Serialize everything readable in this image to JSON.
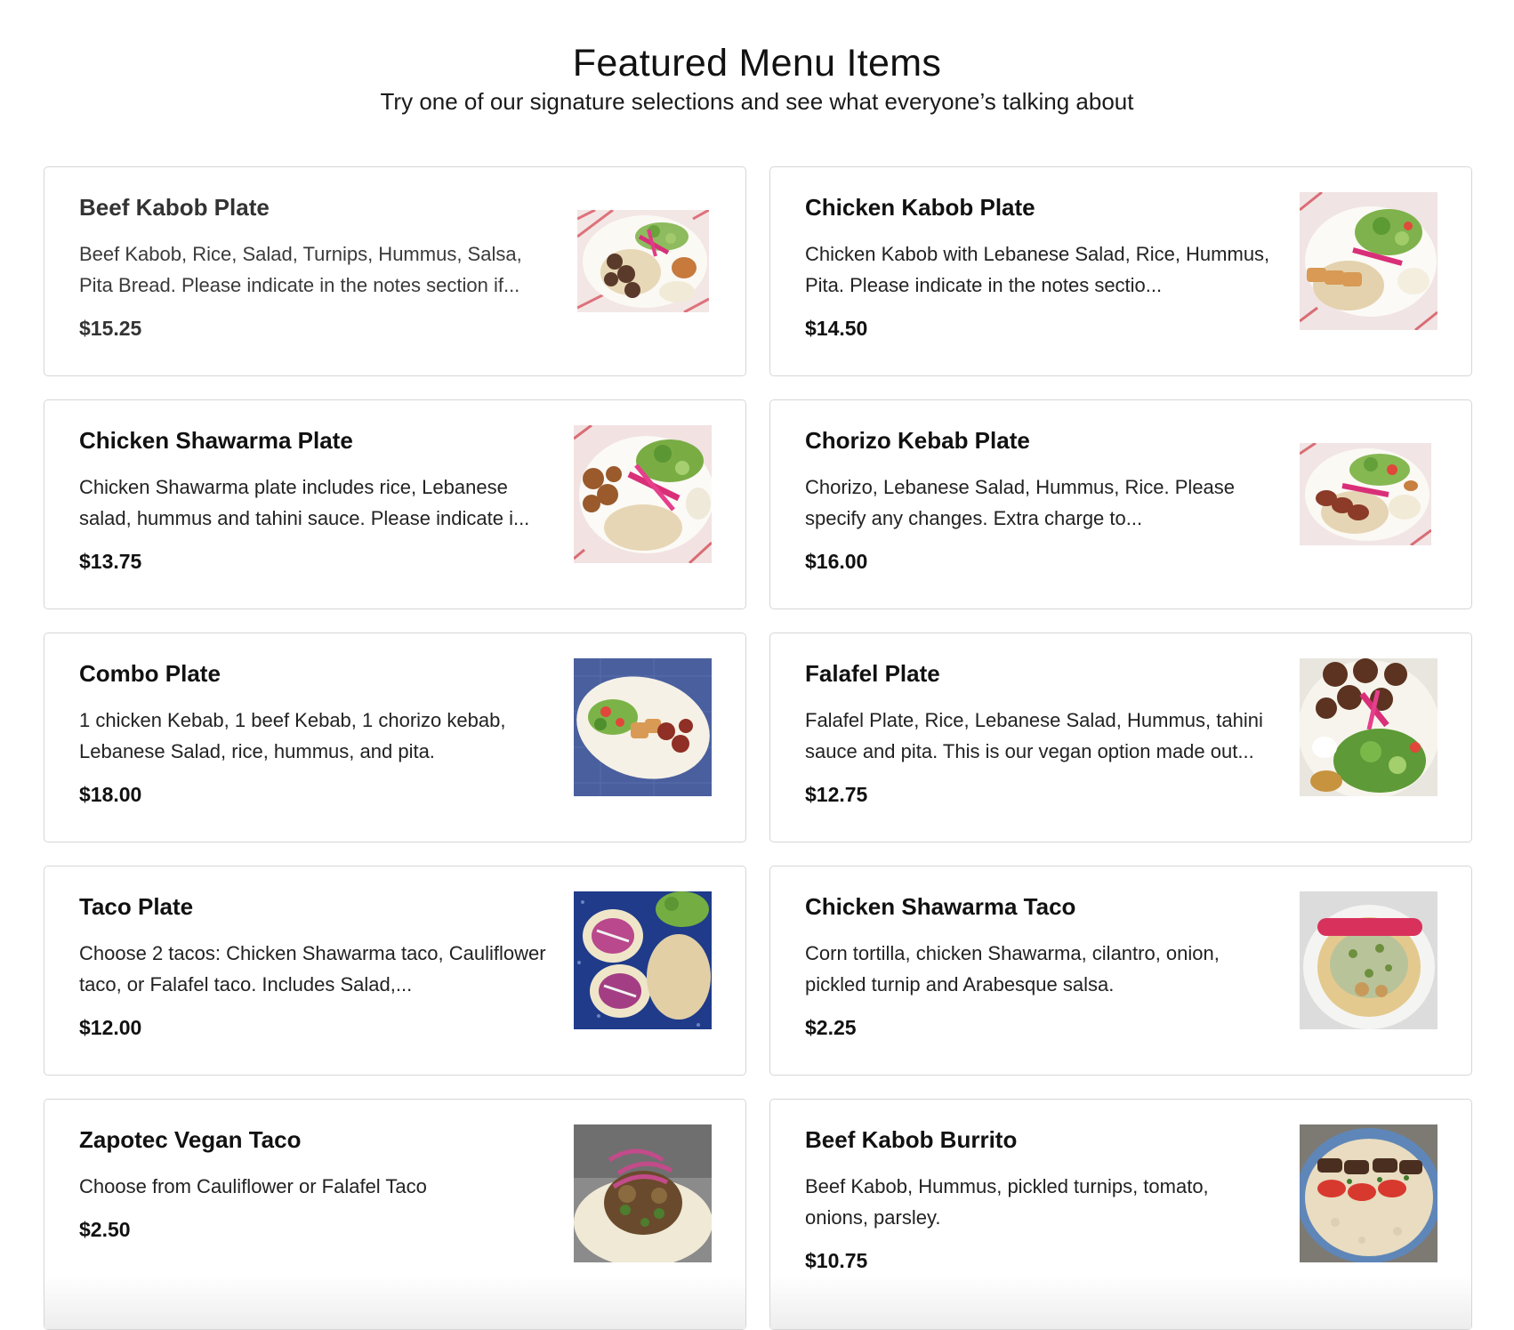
{
  "header": {
    "title": "Featured Menu Items",
    "subtitle": "Try one of our signature selections and see what everyone’s talking about"
  },
  "items": [
    {
      "name": "Beef Kabob Plate",
      "description": "Beef Kabob, Rice, Salad, Turnips, Hummus, Salsa, Pita Bread. Please indicate in the notes section if...",
      "price": "$15.25",
      "image": "beef-kabob-plate-photo"
    },
    {
      "name": "Chicken Kabob Plate",
      "description": "Chicken Kabob with Lebanese Salad, Rice, Hummus, Pita. Please indicate in the notes sectio...",
      "price": "$14.50",
      "image": "chicken-kabob-plate-photo"
    },
    {
      "name": "Chicken Shawarma Plate",
      "description": "Chicken Shawarma plate includes rice, Lebanese salad, hummus and tahini sauce. Please indicate i...",
      "price": "$13.75",
      "image": "chicken-shawarma-plate-photo"
    },
    {
      "name": "Chorizo Kebab Plate",
      "description": "Chorizo, Lebanese Salad, Hummus, Rice. Please specify any changes. Extra charge to...",
      "price": "$16.00",
      "image": "chorizo-kebab-plate-photo"
    },
    {
      "name": "Combo Plate",
      "description": "1 chicken Kebab, 1 beef Kebab, 1 chorizo kebab, Lebanese Salad, rice, hummus, and pita.",
      "price": "$18.00",
      "image": "combo-plate-photo"
    },
    {
      "name": "Falafel Plate",
      "description": "Falafel Plate, Rice, Lebanese Salad, Hummus, tahini sauce and pita. This is our vegan option made out...",
      "price": "$12.75",
      "image": "falafel-plate-photo"
    },
    {
      "name": "Taco Plate",
      "description": "Choose 2 tacos: Chicken Shawarma taco, Cauliflower taco, or Falafel taco. Includes Salad,...",
      "price": "$12.00",
      "image": "taco-plate-photo"
    },
    {
      "name": "Chicken Shawarma Taco",
      "description": "Corn tortilla, chicken Shawarma, cilantro, onion, pickled turnip and Arabesque salsa.",
      "price": "$2.25",
      "image": "chicken-shawarma-taco-photo"
    },
    {
      "name": "Zapotec Vegan Taco",
      "description": "Choose from Cauliflower or Falafel Taco",
      "price": "$2.50",
      "image": "zapotec-vegan-taco-photo"
    },
    {
      "name": "Beef Kabob Burrito",
      "description": "Beef Kabob, Hummus, pickled turnips, tomato, onions, parsley.",
      "price": "$10.75",
      "image": "beef-kabob-burrito-photo"
    }
  ]
}
